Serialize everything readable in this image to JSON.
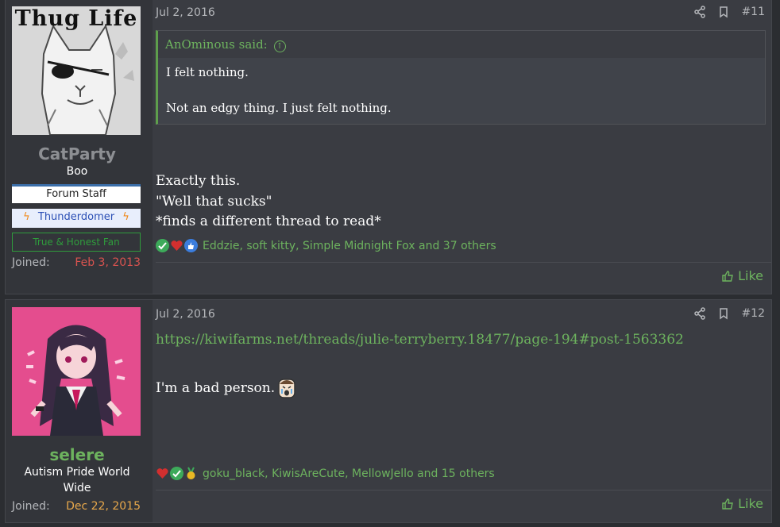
{
  "posts": [
    {
      "username": "CatParty",
      "user_title": "Boo",
      "avatar_text": "Thug Life",
      "banners": [
        "Forum Staff",
        "Thunderdomer",
        "True & Honest Fan"
      ],
      "joined_label": "Joined:",
      "joined_date": "Feb 3, 2013",
      "date": "Jul 2, 2016",
      "post_number": "#11",
      "quote": {
        "author": "AnOminous said:",
        "lines": [
          "I felt nothing.",
          "Not an edgy thing. I just felt nothing."
        ]
      },
      "body": [
        "Exactly this.",
        "\"Well that sucks\"",
        "*finds a different thread to read*"
      ],
      "reactions_text": "Eddzie, soft kitty, Simple Midnight Fox and 37 others",
      "like_label": "Like"
    },
    {
      "username": "selere",
      "user_title": "Autism Pride World Wide",
      "joined_label": "Joined:",
      "joined_date": "Dec 22, 2015",
      "date": "Jul 2, 2016",
      "post_number": "#12",
      "link": "https://kiwifarms.net/threads/julie-terryberry.18477/page-194#post-1563362",
      "body": [
        "I'm a bad person."
      ],
      "reactions_text": "goku_black, KiwisAreCute, MellowJello and 15 others",
      "like_label": "Like"
    }
  ],
  "colors": {
    "username1": "#8d8f93",
    "username2": "#6db35e",
    "joined_date1": "#d9534f",
    "joined_date2": "#e8a84b",
    "accent": "#6db35e"
  }
}
